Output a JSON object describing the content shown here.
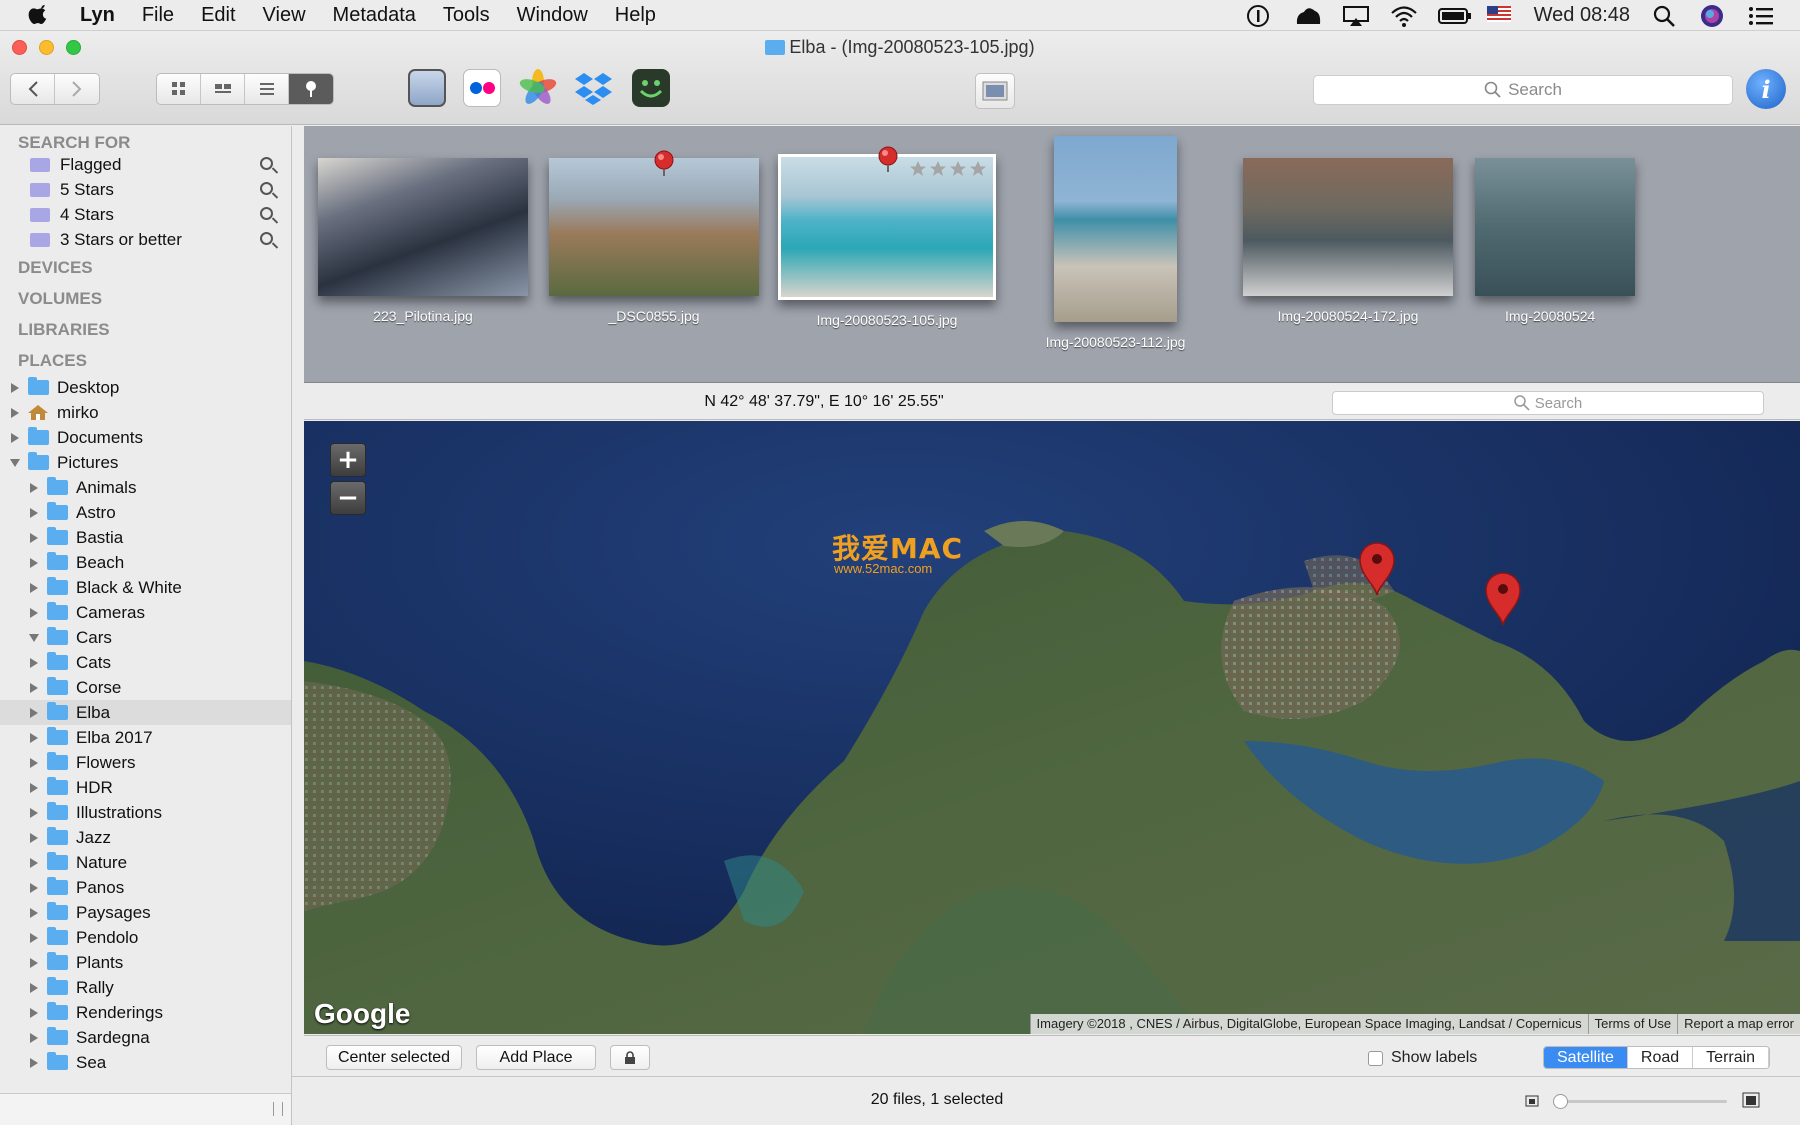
{
  "menubar": {
    "app": "Lyn",
    "items": [
      "File",
      "Edit",
      "View",
      "Metadata",
      "Tools",
      "Window",
      "Help"
    ],
    "clock": "Wed 08:48"
  },
  "window": {
    "title": "Elba - (Img-20080523-105.jpg)",
    "search_placeholder": "Search"
  },
  "sidebar": {
    "search_header": "SEARCH FOR",
    "searches": [
      "Flagged",
      "5 Stars",
      "4 Stars",
      "3 Stars or better"
    ],
    "devices": "DEVICES",
    "volumes": "VOLUMES",
    "libraries": "LIBRARIES",
    "places": "PLACES",
    "top_places": [
      "Desktop",
      "mirko",
      "Documents",
      "Pictures"
    ],
    "pictures_children": [
      "Animals",
      "Astro",
      "Bastia",
      "Beach",
      "Black & White",
      "Cameras",
      "Cars",
      "Cats",
      "Corse",
      "Elba",
      "Elba 2017",
      "Flowers",
      "HDR",
      "Illustrations",
      "Jazz",
      "Nature",
      "Panos",
      "Paysages",
      "Pendolo",
      "Plants",
      "Rally",
      "Renderings",
      "Sardegna",
      "Sea"
    ],
    "selected": "Elba"
  },
  "thumbnails": [
    {
      "name": "223_Pilotina.jpg"
    },
    {
      "name": "_DSC0855.jpg"
    },
    {
      "name": "Img-20080523-105.jpg"
    },
    {
      "name": "Img-20080523-112.jpg"
    },
    {
      "name": "Img-20080524-172.jpg"
    },
    {
      "name": "Img-20080524"
    }
  ],
  "map": {
    "coordinates": "N 42° 48' 37.79\", E 10° 16' 25.55\"",
    "search_placeholder": "Search",
    "logo": "Google",
    "watermark": "我爱MAC",
    "watermark_url": "www.52mac.com",
    "attribution": "Imagery ©2018 , CNES / Airbus, DigitalGlobe, European Space Imaging, Landsat / Copernicus",
    "terms": "Terms of Use",
    "report": "Report a map error",
    "zoom_in": "+",
    "zoom_out": "−"
  },
  "mapbar": {
    "center": "Center selected",
    "add": "Add Place",
    "show_labels": "Show labels",
    "types": [
      "Satellite",
      "Road",
      "Terrain"
    ],
    "active_type": "Satellite"
  },
  "status": {
    "text": "20 files, 1 selected"
  },
  "colors": {
    "accent": "#3b8cf2",
    "folder": "#5aaef0",
    "smart_folder": "#a9a6e6",
    "pin": "#d62c2c"
  }
}
